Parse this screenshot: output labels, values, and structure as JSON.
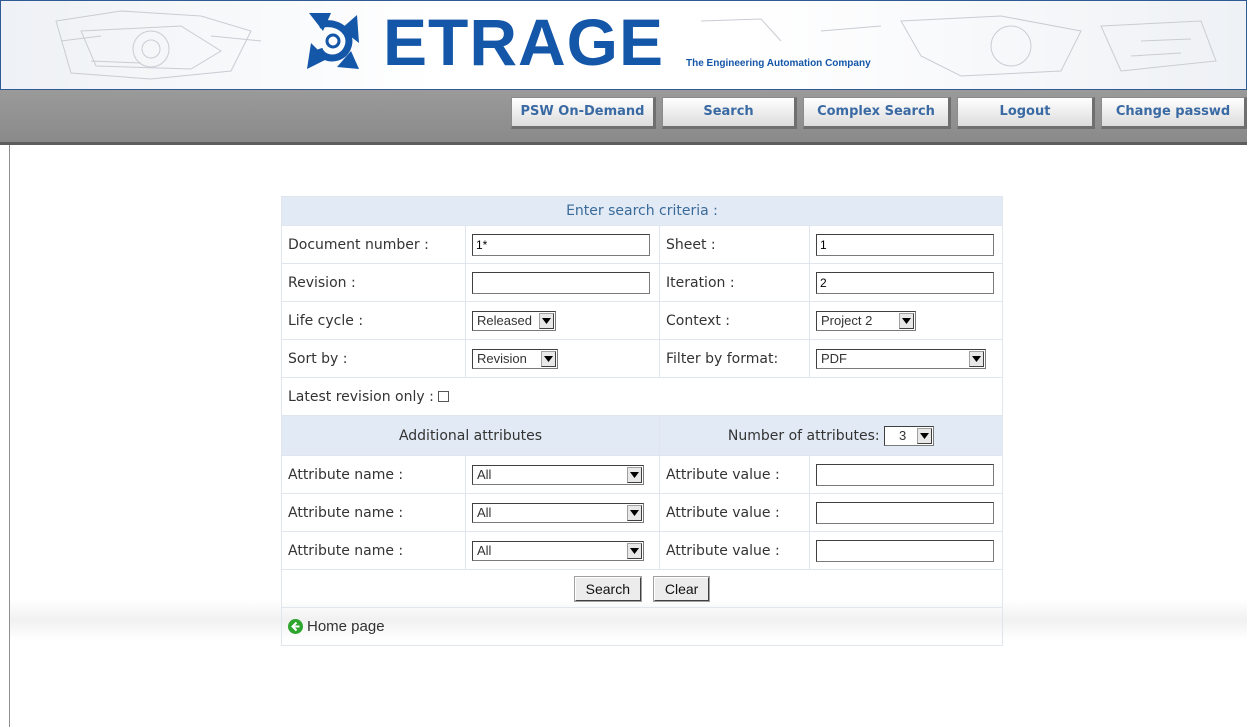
{
  "brand": {
    "name": "ETRAGE",
    "tagline": "The Engineering Automation Company",
    "colors": {
      "primary": "#1456a8",
      "nav_bg": "#8f8f8f",
      "form_header_bg": "#e2ebf5"
    }
  },
  "nav": {
    "items": [
      {
        "label": "PSW On-Demand"
      },
      {
        "label": "Search"
      },
      {
        "label": "Complex Search"
      },
      {
        "label": "Logout"
      },
      {
        "label": "Change passwd"
      }
    ]
  },
  "form": {
    "title": "Enter search criteria :",
    "document_number": {
      "label": "Document number :",
      "value": "1*"
    },
    "sheet": {
      "label": "Sheet :",
      "value": "1"
    },
    "revision": {
      "label": "Revision :",
      "value": ""
    },
    "iteration": {
      "label": "Iteration :",
      "value": "2"
    },
    "life_cycle": {
      "label": "Life cycle :",
      "value": "Released"
    },
    "context": {
      "label": "Context :",
      "value": "Project 2"
    },
    "sort_by": {
      "label": "Sort by :",
      "value": "Revision"
    },
    "filter_by_format": {
      "label": "Filter by format:",
      "value": "PDF"
    },
    "latest_revision_only": {
      "label": "Latest revision only :",
      "checked": false
    },
    "additional_attributes": {
      "label": "Additional attributes"
    },
    "number_of_attributes": {
      "label": "Number of attributes:",
      "value": "3"
    },
    "attributes": [
      {
        "name_label": "Attribute name :",
        "name_value": "All",
        "value_label": "Attribute value :",
        "value": ""
      },
      {
        "name_label": "Attribute name :",
        "name_value": "All",
        "value_label": "Attribute value :",
        "value": ""
      },
      {
        "name_label": "Attribute name :",
        "name_value": "All",
        "value_label": "Attribute value :",
        "value": ""
      }
    ],
    "search_button": "Search",
    "clear_button": "Clear",
    "home_link": "Home page"
  }
}
